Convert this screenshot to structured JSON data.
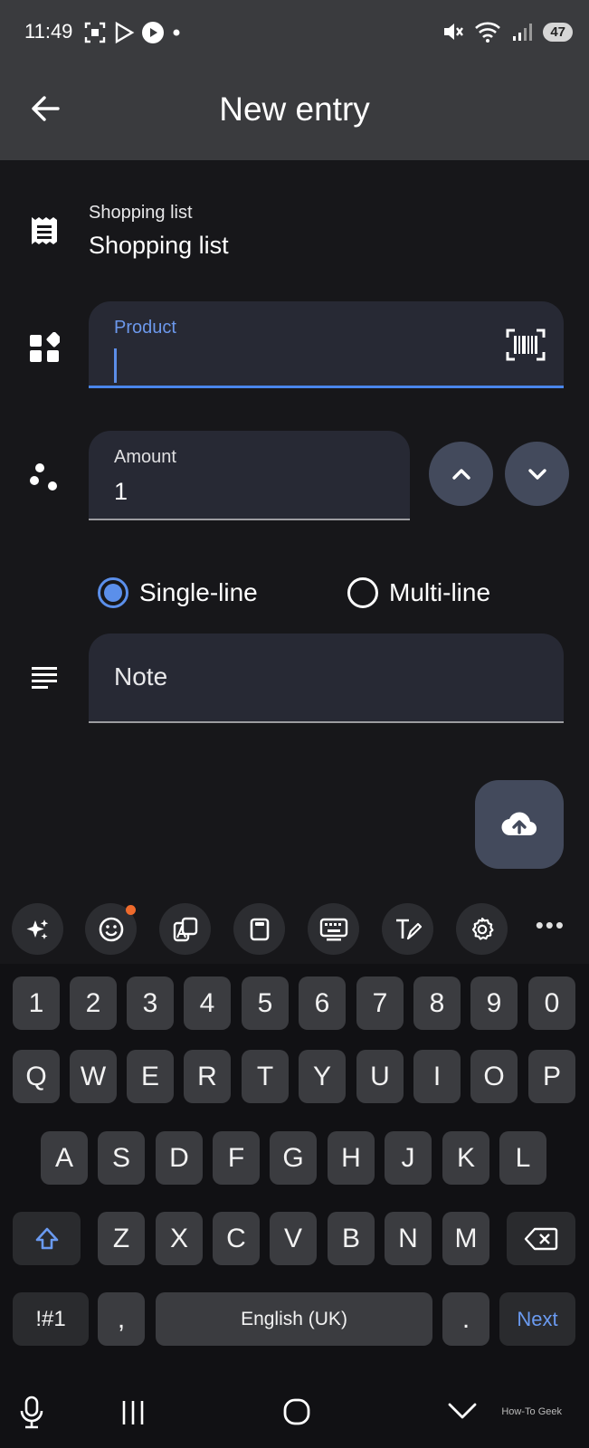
{
  "status_bar": {
    "time": "11:49",
    "battery": "47"
  },
  "app_bar": {
    "title": "New entry"
  },
  "form": {
    "shopping_list_label": "Shopping list",
    "shopping_list_value": "Shopping list",
    "product_label": "Product",
    "product_value": "",
    "amount_label": "Amount",
    "amount_value": "1",
    "mode_single": "Single-line",
    "mode_multi": "Multi-line",
    "selected_mode": "Single-line",
    "note_placeholder": "Note"
  },
  "keyboard": {
    "number_row": [
      "1",
      "2",
      "3",
      "4",
      "5",
      "6",
      "7",
      "8",
      "9",
      "0"
    ],
    "row1": [
      "Q",
      "W",
      "E",
      "R",
      "T",
      "Y",
      "U",
      "I",
      "O",
      "P"
    ],
    "row2": [
      "A",
      "S",
      "D",
      "F",
      "G",
      "H",
      "J",
      "K",
      "L"
    ],
    "row3": [
      "Z",
      "X",
      "C",
      "V",
      "B",
      "N",
      "M"
    ],
    "symbols_label": "!#1",
    "comma": ",",
    "space_label": "English (UK)",
    "period": ".",
    "action_label": "Next"
  },
  "watermark": "How-To Geek",
  "colors": {
    "accent": "#5b8fea",
    "surface": "#272934",
    "background": "#17171a",
    "app_bar": "#3a3b3e"
  }
}
